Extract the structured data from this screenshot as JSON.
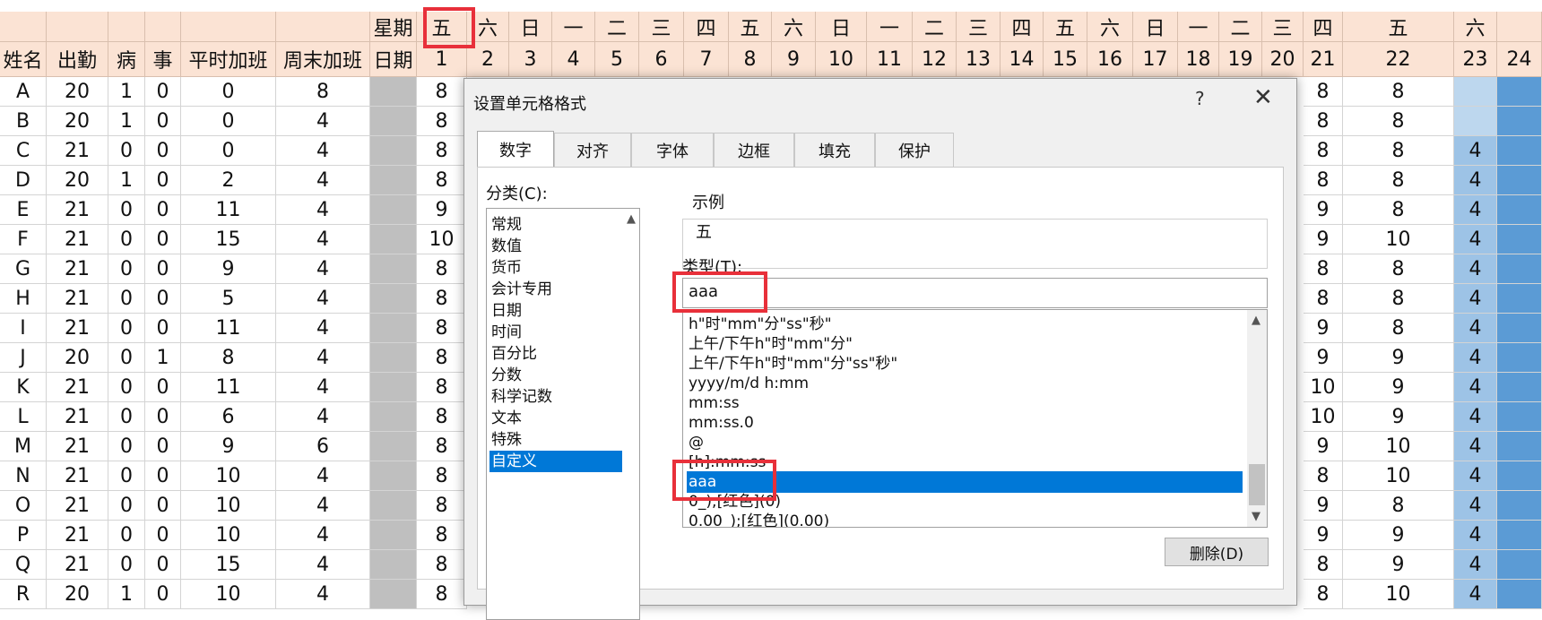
{
  "sheet": {
    "weekday_label": "星期",
    "date_label": "日期",
    "headers": [
      "姓名",
      "出勤",
      "病",
      "事",
      "平时加班",
      "周末加班"
    ],
    "weekdays": [
      "五",
      "六",
      "日",
      "一",
      "二",
      "三",
      "四",
      "五",
      "六",
      "日",
      "一",
      "二",
      "三",
      "四",
      "五",
      "六",
      "日",
      "一",
      "二",
      "三",
      "四",
      "五",
      "六"
    ],
    "dates": [
      "1",
      "2",
      "3",
      "4",
      "5",
      "6",
      "7",
      "8",
      "9",
      "10",
      "11",
      "12",
      "13",
      "14",
      "15",
      "16",
      "17",
      "18",
      "19",
      "20",
      "21",
      "22",
      "23",
      "24"
    ],
    "rows": [
      {
        "name": "A",
        "att": "20",
        "sick": "1",
        "leave": "0",
        "ot": "0",
        "wot": "8",
        "d1": "8",
        "d21": "8",
        "d22": "8",
        "d23": ""
      },
      {
        "name": "B",
        "att": "20",
        "sick": "1",
        "leave": "0",
        "ot": "0",
        "wot": "4",
        "d1": "8",
        "d21": "8",
        "d22": "8",
        "d23": ""
      },
      {
        "name": "C",
        "att": "21",
        "sick": "0",
        "leave": "0",
        "ot": "0",
        "wot": "4",
        "d1": "8",
        "d21": "8",
        "d22": "8",
        "d23": "4"
      },
      {
        "name": "D",
        "att": "20",
        "sick": "1",
        "leave": "0",
        "ot": "2",
        "wot": "4",
        "d1": "8",
        "d21": "8",
        "d22": "8",
        "d23": "4"
      },
      {
        "name": "E",
        "att": "21",
        "sick": "0",
        "leave": "0",
        "ot": "11",
        "wot": "4",
        "d1": "9",
        "d21": "9",
        "d22": "8",
        "d23": "4"
      },
      {
        "name": "F",
        "att": "21",
        "sick": "0",
        "leave": "0",
        "ot": "15",
        "wot": "4",
        "d1": "10",
        "d21": "9",
        "d22": "10",
        "d23": "4"
      },
      {
        "name": "G",
        "att": "21",
        "sick": "0",
        "leave": "0",
        "ot": "9",
        "wot": "4",
        "d1": "8",
        "d21": "8",
        "d22": "8",
        "d23": "4"
      },
      {
        "name": "H",
        "att": "21",
        "sick": "0",
        "leave": "0",
        "ot": "5",
        "wot": "4",
        "d1": "8",
        "d21": "8",
        "d22": "8",
        "d23": "4"
      },
      {
        "name": "I",
        "att": "21",
        "sick": "0",
        "leave": "0",
        "ot": "11",
        "wot": "4",
        "d1": "8",
        "d21": "9",
        "d22": "8",
        "d23": "4"
      },
      {
        "name": "J",
        "att": "20",
        "sick": "0",
        "leave": "1",
        "ot": "8",
        "wot": "4",
        "d1": "8",
        "d21": "9",
        "d22": "9",
        "d23": "4"
      },
      {
        "name": "K",
        "att": "21",
        "sick": "0",
        "leave": "0",
        "ot": "11",
        "wot": "4",
        "d1": "8",
        "d21": "10",
        "d22": "9",
        "d23": "4"
      },
      {
        "name": "L",
        "att": "21",
        "sick": "0",
        "leave": "0",
        "ot": "6",
        "wot": "4",
        "d1": "8",
        "d21": "10",
        "d22": "9",
        "d23": "4"
      },
      {
        "name": "M",
        "att": "21",
        "sick": "0",
        "leave": "0",
        "ot": "9",
        "wot": "6",
        "d1": "8",
        "d21": "9",
        "d22": "10",
        "d23": "4"
      },
      {
        "name": "N",
        "att": "21",
        "sick": "0",
        "leave": "0",
        "ot": "10",
        "wot": "4",
        "d1": "8",
        "d21": "8",
        "d22": "10",
        "d23": "4"
      },
      {
        "name": "O",
        "att": "21",
        "sick": "0",
        "leave": "0",
        "ot": "10",
        "wot": "4",
        "d1": "8",
        "d21": "9",
        "d22": "8",
        "d23": "4"
      },
      {
        "name": "P",
        "att": "21",
        "sick": "0",
        "leave": "0",
        "ot": "10",
        "wot": "4",
        "d1": "8",
        "d21": "9",
        "d22": "9",
        "d23": "4"
      },
      {
        "name": "Q",
        "att": "21",
        "sick": "0",
        "leave": "0",
        "ot": "15",
        "wot": "4",
        "d1": "8",
        "d21": "8",
        "d22": "9",
        "d23": "4"
      },
      {
        "name": "R",
        "att": "20",
        "sick": "1",
        "leave": "0",
        "ot": "10",
        "wot": "4",
        "d1": "8",
        "d21": "8",
        "d22": "10",
        "d23": "4"
      }
    ]
  },
  "dialog": {
    "title": "设置单元格格式",
    "help": "?",
    "close": "✕",
    "tabs": [
      "数字",
      "对齐",
      "字体",
      "边框",
      "填充",
      "保护"
    ],
    "category_label": "分类(C):",
    "categories": [
      "常规",
      "数值",
      "货币",
      "会计专用",
      "日期",
      "时间",
      "百分比",
      "分数",
      "科学记数",
      "文本",
      "特殊",
      "自定义"
    ],
    "selected_category": "自定义",
    "sample_label": "示例",
    "sample_value": "五",
    "type_label": "类型(T):",
    "type_value": "aaa",
    "formats": [
      "h\"时\"mm\"分\"ss\"秒\"",
      "上午/下午h\"时\"mm\"分\"",
      "上午/下午h\"时\"mm\"分\"ss\"秒\"",
      "yyyy/m/d h:mm",
      "mm:ss",
      "mm:ss.0",
      "@",
      "[h]:mm:ss",
      "aaa",
      "0_);[红色](0)",
      "0.00_);[红色](0.00)"
    ],
    "selected_format": "aaa",
    "delete_label": "删除(D)"
  },
  "colors": {
    "header_bg": "#fbe3d4",
    "highlight": "#e8303a",
    "selection": "#0078d7"
  }
}
